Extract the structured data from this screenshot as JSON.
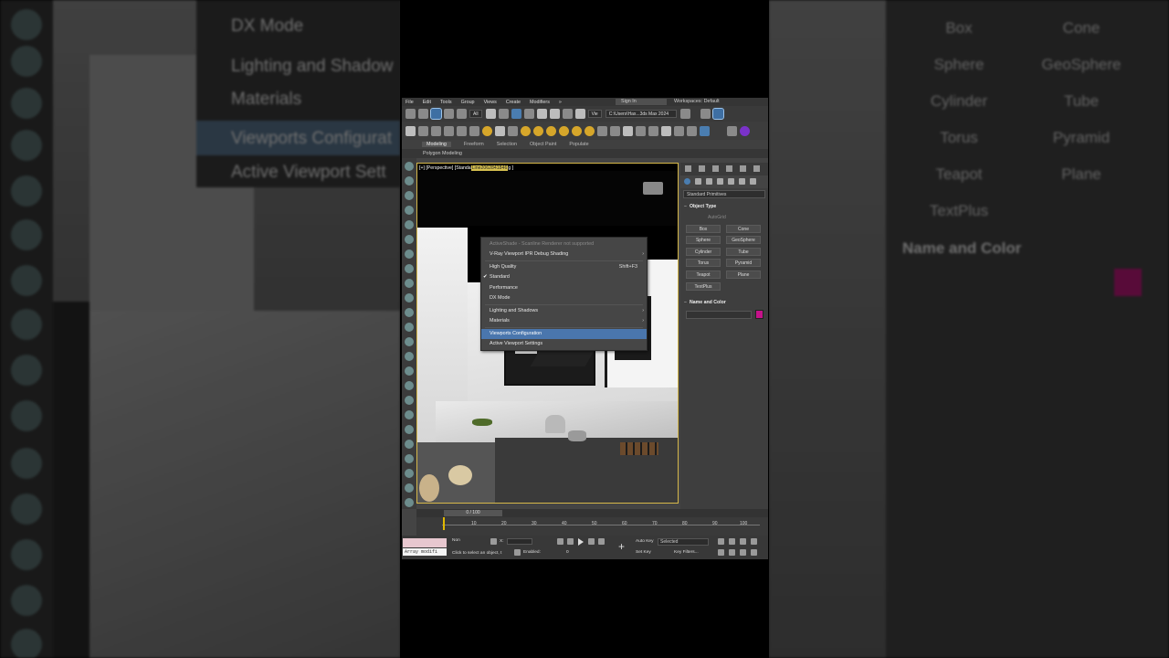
{
  "menubar": {
    "items": [
      "File",
      "Edit",
      "Tools",
      "Group",
      "Views",
      "Create",
      "Modifiers"
    ],
    "overflow": "»",
    "sign_in": "Sign In",
    "workspaces_label": "Workspaces:",
    "workspace_value": "Default"
  },
  "toolbar": {
    "selection_filter": "All",
    "view_dropdown": "Vie",
    "path_dropdown": "C:\\Users\\Hax...3ds Max 2024"
  },
  "ribbon": {
    "tabs": [
      "Modeling",
      "Freeform",
      "Selection",
      "Object Paint",
      "Populate"
    ],
    "active_tab": "Modeling",
    "panel_title": "Polygon Modeling"
  },
  "viewport": {
    "label": "[+] [Perspective] [Standa",
    "label_highlight": "Line2062841846",
    "label_tail": "g ]"
  },
  "context_menu": {
    "items": [
      {
        "label": "ActiveShade - Scanline Renderer not supported",
        "disabled": true
      },
      {
        "label": "V-Ray Viewport IPR Debug Shading",
        "submenu": true
      },
      {
        "label": "High Quality",
        "shortcut": "Shift+F3"
      },
      {
        "label": "Standard",
        "checked": true
      },
      {
        "label": "Performance"
      },
      {
        "label": "DX Mode"
      },
      {
        "label": "Lighting and Shadows",
        "submenu": true
      },
      {
        "label": "Materials",
        "submenu": true
      },
      {
        "label": "Viewports Configuration",
        "highlighted": true
      },
      {
        "label": "Active Viewport Settings"
      }
    ],
    "check_glyph": "✔",
    "submenu_glyph": "›"
  },
  "command_panel": {
    "category": "Standard Primitives",
    "object_type_title": "Object Type",
    "autogrid": "AutoGrid",
    "buttons": [
      "Box",
      "Cone",
      "Sphere",
      "GeoSphere",
      "Cylinder",
      "Tube",
      "Torus",
      "Pyramid",
      "Teapot",
      "Plane",
      "TextPlus"
    ],
    "name_color_title": "Name and Color",
    "color_swatch": "#c5128a"
  },
  "timeline": {
    "frame_display": "0 / 100",
    "ticks": [
      "10",
      "20",
      "30",
      "40",
      "50",
      "60",
      "70",
      "80",
      "90",
      "100"
    ]
  },
  "status_bar": {
    "maxscript_text": "Array modifi",
    "selection_count": "Non",
    "prompt": "Click to select an object, t",
    "x_label": "X:",
    "enabled_label": "Enabled:",
    "frame_value": "0",
    "auto_key": "Auto Key",
    "set_key": "Set Key",
    "selected_dropdown": "Selected",
    "key_filters": "Key Filters..."
  },
  "background_mirror": {
    "menu_items": [
      "DX Mode",
      "Lighting and Shadow",
      "Materials",
      "Viewports Configurat",
      "Active Viewport Sett"
    ],
    "buttons": [
      "Box",
      "Cone",
      "Sphere",
      "GeoSphere",
      "Cylinder",
      "Tube",
      "Torus",
      "Pyramid",
      "Teapot",
      "Plane",
      "TextPlus"
    ],
    "name_color_title": "Name and Color"
  },
  "colors": {
    "accent_blue": "#4a76ad",
    "viewport_border": "#d6b84a",
    "timeline_cursor": "#e0b800"
  }
}
